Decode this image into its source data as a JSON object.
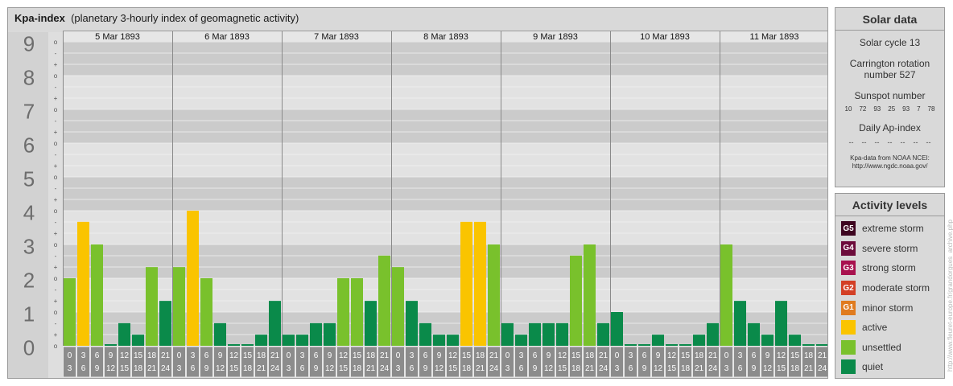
{
  "header": {
    "title": "Kpa-index",
    "subtitle": "(planetary 3-hourly index of geomagnetic activity)"
  },
  "chart_data": {
    "type": "bar",
    "y_range": [
      0,
      9
    ],
    "y_ticks": [
      "0",
      "1",
      "2",
      "3",
      "4",
      "5",
      "6",
      "7",
      "8",
      "9"
    ],
    "sub_ticks": [
      "-",
      "o",
      "+"
    ],
    "days": [
      "5 Mar 1893",
      "6 Mar 1893",
      "7 Mar 1893",
      "8 Mar 1893",
      "9 Mar 1893",
      "10 Mar 1893",
      "11 Mar 1893"
    ],
    "interval_starts": [
      "0",
      "3",
      "6",
      "9",
      "12",
      "15",
      "18",
      "21"
    ],
    "interval_ends": [
      "3",
      "6",
      "9",
      "12",
      "15",
      "18",
      "21",
      "24"
    ],
    "values": [
      [
        2.0,
        3.67,
        3.0,
        0.0,
        0.67,
        0.33,
        2.33,
        1.33
      ],
      [
        2.33,
        4.0,
        2.0,
        0.67,
        0.0,
        0.0,
        0.33,
        1.33
      ],
      [
        0.33,
        0.33,
        0.67,
        0.67,
        2.0,
        2.0,
        1.33,
        2.67
      ],
      [
        2.33,
        1.33,
        0.67,
        0.33,
        0.33,
        3.67,
        3.67,
        3.0
      ],
      [
        0.67,
        0.33,
        0.67,
        0.67,
        0.67,
        2.67,
        3.0,
        0.67
      ],
      [
        1.0,
        0.0,
        0.0,
        0.33,
        0.0,
        0.0,
        0.33,
        0.67
      ],
      [
        3.0,
        1.33,
        0.67,
        0.33,
        1.33,
        0.33,
        0.0,
        0.0
      ]
    ]
  },
  "colors": {
    "quiet": "#0a8a4a",
    "unsettled": "#79c12c",
    "active": "#fac400",
    "minor_storm": "#e07b1e",
    "moderate_storm": "#d33f25",
    "strong_storm": "#a8114e",
    "severe_storm": "#6c0b3a",
    "extreme_storm": "#3e0520"
  },
  "solar": {
    "title": "Solar data",
    "cycle": "Solar cycle 13",
    "carrington_line1": "Carrington rotation",
    "carrington_line2": "number 527",
    "sunspot_title": "Sunspot number",
    "sunspot_values": [
      "10",
      "72",
      "93",
      "25",
      "93",
      "7",
      "78"
    ],
    "ap_title": "Daily Ap-index",
    "ap_values": [
      "--",
      "--",
      "--",
      "--",
      "--",
      "--",
      "--"
    ],
    "source_line1": "Kpa-data from NOAA NCEI:",
    "source_line2": "http://www.ngdc.noaa.gov/"
  },
  "activity": {
    "title": "Activity levels",
    "levels": [
      {
        "code": "G5",
        "label": "extreme storm",
        "color": "#3e0520"
      },
      {
        "code": "G4",
        "label": "severe storm",
        "color": "#6c0b3a"
      },
      {
        "code": "G3",
        "label": "strong storm",
        "color": "#a8114e"
      },
      {
        "code": "G2",
        "label": "moderate storm",
        "color": "#d33f25"
      },
      {
        "code": "G1",
        "label": "minor storm",
        "color": "#e07b1e"
      },
      {
        "code": "",
        "label": "active",
        "color": "#fac400"
      },
      {
        "code": "",
        "label": "unsettled",
        "color": "#79c12c"
      },
      {
        "code": "",
        "label": "quiet",
        "color": "#0a8a4a"
      }
    ]
  },
  "watermark": "http://www.fleuret-europe.fr/grandorgues_archive.php"
}
